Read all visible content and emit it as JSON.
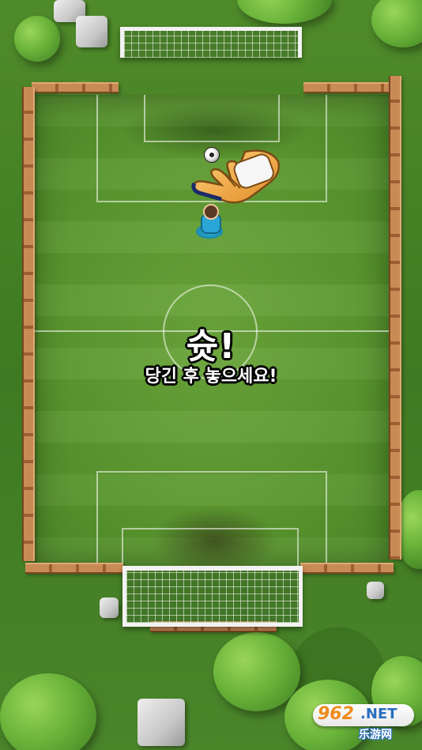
{
  "game": {
    "shoot_text": "슛!",
    "instruction_text": "당긴 후 놓으세요!"
  },
  "watermark": {
    "number": "962",
    "suffix": ".NET",
    "subtitle": "乐游网"
  },
  "colors": {
    "grass": "#5b972f",
    "fence": "#c98b55",
    "player_kit": "#2aa6d6",
    "glove": "#f3a94a"
  },
  "icons": {
    "ball": "soccer-ball-icon",
    "glove": "goalkeeper-glove-icon"
  }
}
